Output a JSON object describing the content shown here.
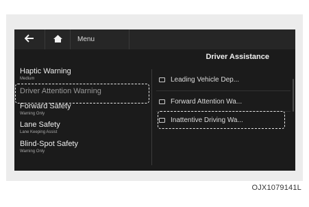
{
  "topbar": {
    "back_icon": "arrow-left-icon",
    "home_icon": "home-icon",
    "menu_label": "Menu"
  },
  "section_title": "Driver Assistance",
  "left_menu": [
    {
      "title": "Haptic Warning",
      "subtitle": "Medium"
    },
    {
      "title": "Driver Attention Warning",
      "subtitle": ""
    },
    {
      "title": "Forward Safety",
      "subtitle": "Warning Only"
    },
    {
      "title": "Lane Safety",
      "subtitle": "Lane Keeping Assist"
    },
    {
      "title": "Blind-Spot Safety",
      "subtitle": "Warning Only"
    }
  ],
  "right_menu": [
    {
      "label": "Leading Vehicle Dep..."
    },
    {
      "label": "Forward Attention Wa..."
    },
    {
      "label": "Inattentive Driving Wa..."
    }
  ],
  "caption": "OJX1079141L"
}
